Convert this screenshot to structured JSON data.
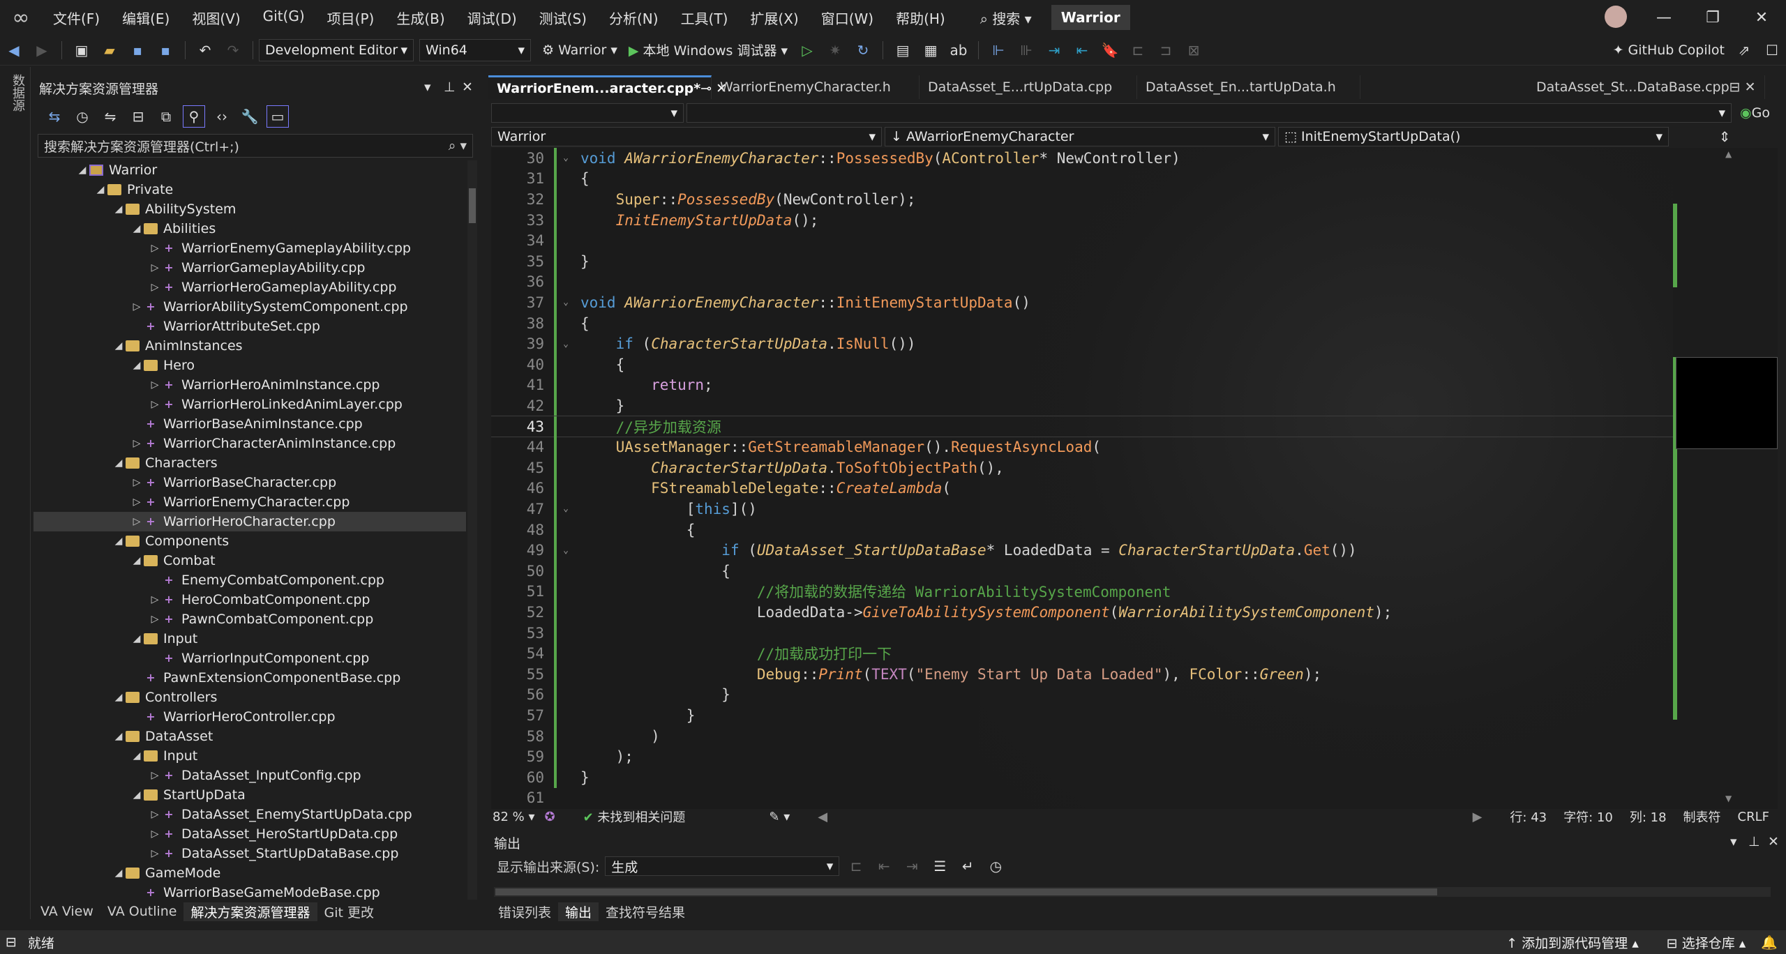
{
  "titlebar": {
    "menus": [
      "文件(F)",
      "编辑(E)",
      "视图(V)",
      "Git(G)",
      "项目(P)",
      "生成(B)",
      "调试(D)",
      "测试(S)",
      "分析(N)",
      "工具(T)",
      "扩展(X)",
      "窗口(W)",
      "帮助(H)"
    ],
    "search_label": "搜索",
    "solution_name": "Warrior"
  },
  "toolbar": {
    "config": "Development Editor",
    "platform": "Win64",
    "startup_project": "Warrior",
    "run_label": "本地 Windows 调试器",
    "copilot": "GitHub Copilot"
  },
  "left_strip_label": "数据源",
  "solution_explorer": {
    "title": "解决方案资源管理器",
    "search_placeholder": "搜索解决方案资源管理器(Ctrl+;)",
    "tree": [
      {
        "label": "Warrior",
        "level": 0,
        "type": "proj",
        "twisty": "◢"
      },
      {
        "label": "Private",
        "level": 1,
        "type": "folder",
        "twisty": "◢"
      },
      {
        "label": "AbilitySystem",
        "level": 2,
        "type": "folder",
        "twisty": "◢"
      },
      {
        "label": "Abilities",
        "level": 3,
        "type": "folder",
        "twisty": "◢"
      },
      {
        "label": "WarriorEnemyGameplayAbility.cpp",
        "level": 4,
        "type": "cpp",
        "twisty": "▷"
      },
      {
        "label": "WarriorGameplayAbility.cpp",
        "level": 4,
        "type": "cpp",
        "twisty": "▷"
      },
      {
        "label": "WarriorHeroGameplayAbility.cpp",
        "level": 4,
        "type": "cpp",
        "twisty": "▷"
      },
      {
        "label": "WarriorAbilitySystemComponent.cpp",
        "level": 3,
        "type": "cpp",
        "twisty": "▷"
      },
      {
        "label": "WarriorAttributeSet.cpp",
        "level": 3,
        "type": "cpp",
        "twisty": ""
      },
      {
        "label": "AnimInstances",
        "level": 2,
        "type": "folder",
        "twisty": "◢"
      },
      {
        "label": "Hero",
        "level": 3,
        "type": "folder",
        "twisty": "◢"
      },
      {
        "label": "WarriorHeroAnimInstance.cpp",
        "level": 4,
        "type": "cpp",
        "twisty": "▷"
      },
      {
        "label": "WarriorHeroLinkedAnimLayer.cpp",
        "level": 4,
        "type": "cpp",
        "twisty": "▷"
      },
      {
        "label": "WarriorBaseAnimInstance.cpp",
        "level": 3,
        "type": "cpp",
        "twisty": ""
      },
      {
        "label": "WarriorCharacterAnimInstance.cpp",
        "level": 3,
        "type": "cpp",
        "twisty": "▷"
      },
      {
        "label": "Characters",
        "level": 2,
        "type": "folder",
        "twisty": "◢"
      },
      {
        "label": "WarriorBaseCharacter.cpp",
        "level": 3,
        "type": "cpp",
        "twisty": "▷"
      },
      {
        "label": "WarriorEnemyCharacter.cpp",
        "level": 3,
        "type": "cpp",
        "twisty": "▷"
      },
      {
        "label": "WarriorHeroCharacter.cpp",
        "level": 3,
        "type": "cpp",
        "twisty": "▷",
        "selected": true
      },
      {
        "label": "Components",
        "level": 2,
        "type": "folder",
        "twisty": "◢"
      },
      {
        "label": "Combat",
        "level": 3,
        "type": "folder",
        "twisty": "◢"
      },
      {
        "label": "EnemyCombatComponent.cpp",
        "level": 4,
        "type": "cpp",
        "twisty": ""
      },
      {
        "label": "HeroCombatComponent.cpp",
        "level": 4,
        "type": "cpp",
        "twisty": "▷"
      },
      {
        "label": "PawnCombatComponent.cpp",
        "level": 4,
        "type": "cpp",
        "twisty": "▷"
      },
      {
        "label": "Input",
        "level": 3,
        "type": "folder",
        "twisty": "◢"
      },
      {
        "label": "WarriorInputComponent.cpp",
        "level": 4,
        "type": "cpp",
        "twisty": ""
      },
      {
        "label": "PawnExtensionComponentBase.cpp",
        "level": 3,
        "type": "cpp",
        "twisty": ""
      },
      {
        "label": "Controllers",
        "level": 2,
        "type": "folder",
        "twisty": "◢"
      },
      {
        "label": "WarriorHeroController.cpp",
        "level": 3,
        "type": "cpp",
        "twisty": ""
      },
      {
        "label": "DataAsset",
        "level": 2,
        "type": "folder",
        "twisty": "◢"
      },
      {
        "label": "Input",
        "level": 3,
        "type": "folder",
        "twisty": "◢"
      },
      {
        "label": "DataAsset_InputConfig.cpp",
        "level": 4,
        "type": "cpp",
        "twisty": "▷"
      },
      {
        "label": "StartUpData",
        "level": 3,
        "type": "folder",
        "twisty": "◢"
      },
      {
        "label": "DataAsset_EnemyStartUpData.cpp",
        "level": 4,
        "type": "cpp",
        "twisty": "▷"
      },
      {
        "label": "DataAsset_HeroStartUpData.cpp",
        "level": 4,
        "type": "cpp",
        "twisty": "▷"
      },
      {
        "label": "DataAsset_StartUpDataBase.cpp",
        "level": 4,
        "type": "cpp",
        "twisty": "▷"
      },
      {
        "label": "GameMode",
        "level": 2,
        "type": "folder",
        "twisty": "◢"
      },
      {
        "label": "WarriorBaseGameModeBase.cpp",
        "level": 3,
        "type": "cpp",
        "twisty": ""
      }
    ],
    "bottom_tabs": [
      "VA View",
      "VA Outline",
      "解决方案资源管理器",
      "Git 更改"
    ]
  },
  "editor": {
    "tabs": [
      {
        "label": "WarriorEnem...aracter.cpp*",
        "active": true
      },
      {
        "label": "WarriorEnemyCharacter.h",
        "active": false
      },
      {
        "label": "DataAsset_E...rtUpData.cpp",
        "active": false
      },
      {
        "label": "DataAsset_En...tartUpData.h",
        "active": false
      },
      {
        "label": "DataAsset_St...DataBase.cpp",
        "active": false
      }
    ],
    "nav_project": "Warrior",
    "nav_class": "AWarriorEnemyCharacter",
    "nav_member": "InitEnemyStartUpData()",
    "go_label": "Go",
    "current_line": 43,
    "lines": [
      {
        "n": 30,
        "fold": "⌄",
        "html": "<span class='kw'>void</span> <span class='ivar'>AWarriorEnemyCharacter</span><span class='plain'>::</span><span class='fn'>PossessedBy</span><span class='plain'>(</span><span class='cls'>AController</span><span class='plain'>* NewController)</span>"
      },
      {
        "n": 31,
        "fold": "",
        "html": "<span class='plain'>{</span>"
      },
      {
        "n": 32,
        "fold": "",
        "html": "    <span class='cls'>Super</span><span class='plain'>::</span><span class='fni'>PossessedBy</span><span class='plain'>(NewController);</span>"
      },
      {
        "n": 33,
        "fold": "",
        "html": "    <span class='fni'>InitEnemyStartUpData</span><span class='plain'>();</span>"
      },
      {
        "n": 34,
        "fold": "",
        "html": ""
      },
      {
        "n": 35,
        "fold": "",
        "html": "<span class='plain'>}</span>"
      },
      {
        "n": 36,
        "fold": "",
        "html": ""
      },
      {
        "n": 37,
        "fold": "⌄",
        "html": "<span class='kw'>void</span> <span class='ivar'>AWarriorEnemyCharacter</span><span class='plain'>::</span><span class='fn'>InitEnemyStartUpData</span><span class='plain'>()</span>"
      },
      {
        "n": 38,
        "fold": "",
        "html": "<span class='plain'>{</span>"
      },
      {
        "n": 39,
        "fold": "⌄",
        "html": "    <span class='kw'>if</span> <span class='plain'>(</span><span class='ivar'>CharacterStartUpData</span><span class='plain'>.</span><span class='fn'>IsNull</span><span class='plain'>())</span>"
      },
      {
        "n": 40,
        "fold": "",
        "html": "    <span class='plain'>{</span>"
      },
      {
        "n": 41,
        "fold": "",
        "html": "        <span class='pink'>return</span><span class='plain'>;</span>"
      },
      {
        "n": 42,
        "fold": "",
        "html": "    <span class='plain'>}</span>"
      },
      {
        "n": 43,
        "fold": "",
        "html": "    <span class='cmt'>//异步加载资源</span>"
      },
      {
        "n": 44,
        "fold": "",
        "html": "    <span class='cls'>UAssetManager</span><span class='plain'>::</span><span class='fn'>GetStreamableManager</span><span class='plain'>().</span><span class='fn'>RequestAsyncLoad</span><span class='plain'>(</span>"
      },
      {
        "n": 45,
        "fold": "",
        "html": "        <span class='ivar'>CharacterStartUpData</span><span class='plain'>.</span><span class='fn'>ToSoftObjectPath</span><span class='plain'>(),</span>"
      },
      {
        "n": 46,
        "fold": "",
        "html": "        <span class='cls'>FStreamableDelegate</span><span class='plain'>::</span><span class='fni'>CreateLambda</span><span class='plain'>(</span>"
      },
      {
        "n": 47,
        "fold": "⌄",
        "html": "            <span class='plain'>[</span><span class='kw'>this</span><span class='plain'>]()</span>"
      },
      {
        "n": 48,
        "fold": "",
        "html": "            <span class='plain'>{</span>"
      },
      {
        "n": 49,
        "fold": "⌄",
        "html": "                <span class='kw'>if</span> <span class='plain'>(</span><span class='ivar'>UDataAsset_StartUpDataBase</span><span class='plain'>* LoadedData = </span><span class='ivar'>CharacterStartUpData</span><span class='plain'>.</span><span class='fn'>Get</span><span class='plain'>())</span>"
      },
      {
        "n": 50,
        "fold": "",
        "html": "                <span class='plain'>{</span>"
      },
      {
        "n": 51,
        "fold": "",
        "html": "                    <span class='cmt'>//将加载的数据传递给 WarriorAbilitySystemComponent</span>"
      },
      {
        "n": 52,
        "fold": "",
        "html": "                    <span class='plain'>LoadedData-></span><span class='fni'>GiveToAbilitySystemComponent</span><span class='plain'>(</span><span class='ivar'>WarriorAbilitySystemComponent</span><span class='plain'>);</span>"
      },
      {
        "n": 53,
        "fold": "",
        "html": ""
      },
      {
        "n": 54,
        "fold": "",
        "html": "                    <span class='cmt'>//加载成功打印一下</span>"
      },
      {
        "n": 55,
        "fold": "",
        "html": "                    <span class='cls'>Debug</span><span class='plain'>::</span><span class='fni'>Print</span><span class='plain'>(</span><span class='mac'>TEXT</span><span class='plain'>(</span><span class='str'>\"Enemy Start Up Data Loaded\"</span><span class='plain'>), </span><span class='cls'>FColor</span><span class='plain'>::</span><span class='ivar'>Green</span><span class='plain'>);</span>"
      },
      {
        "n": 56,
        "fold": "",
        "html": "                <span class='plain'>}</span>"
      },
      {
        "n": 57,
        "fold": "",
        "html": "            <span class='plain'>}</span>"
      },
      {
        "n": 58,
        "fold": "",
        "html": "        <span class='plain'>)</span>"
      },
      {
        "n": 59,
        "fold": "",
        "html": "    <span class='plain'>);</span>"
      },
      {
        "n": 60,
        "fold": "",
        "html": "<span class='plain'>}</span>"
      },
      {
        "n": 61,
        "fold": "",
        "html": ""
      }
    ],
    "zoom": "82 %",
    "issues": "未找到相关问题",
    "row": "行: 43",
    "char": "字符: 10",
    "col": "列: 18",
    "tabs_mode": "制表符",
    "eol": "CRLF"
  },
  "output": {
    "title": "输出",
    "source_label": "显示输出来源(S):",
    "source_value": "生成",
    "tabs": [
      "错误列表",
      "输出",
      "查找符号结果"
    ]
  },
  "statusbar": {
    "ready": "就绪",
    "add_source_control": "添加到源代码管理",
    "select_repo": "选择仓库"
  }
}
